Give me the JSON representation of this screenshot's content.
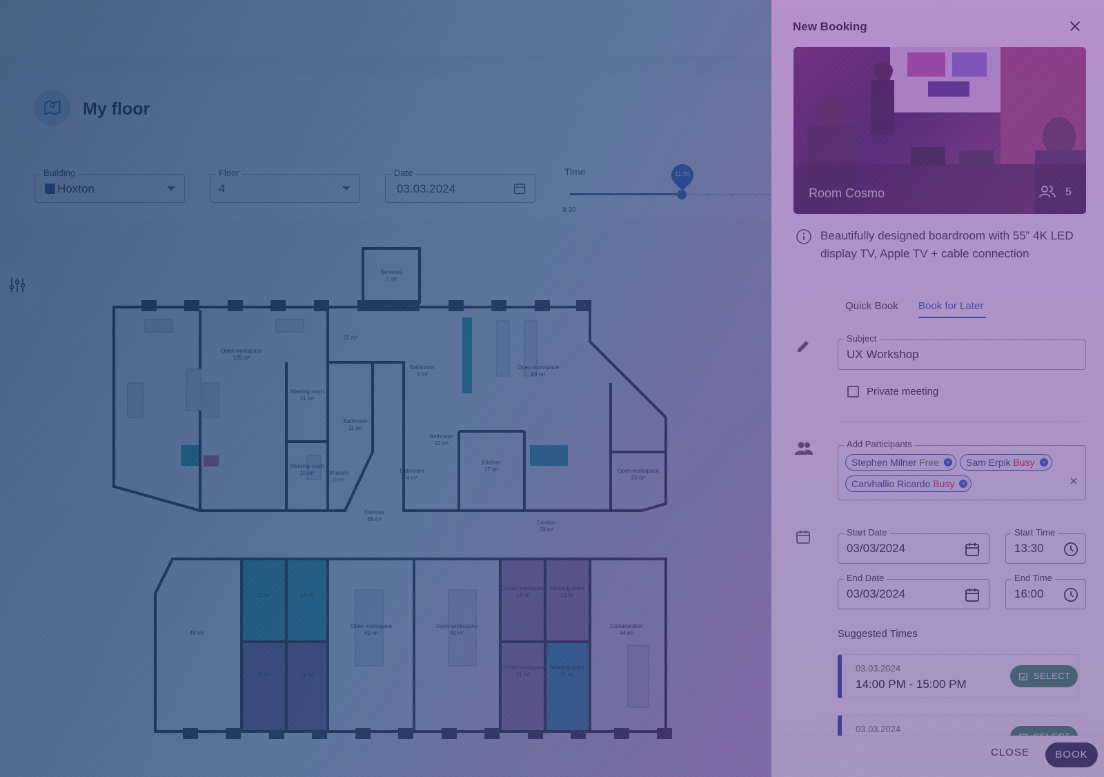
{
  "page": {
    "title": "My floor"
  },
  "filters": {
    "building_label": "Building",
    "building_value": "Hoxton",
    "floor_label": "Floor",
    "floor_value": "4",
    "date_label": "Date",
    "date_value": "03.03.2024",
    "time_label": "Time",
    "time_value": "11:00",
    "time_start": "8:30"
  },
  "floorplan": {
    "rooms": [
      {
        "name": "Services",
        "area": "7 m²"
      },
      {
        "name": "Open workspace",
        "area": "125 m²"
      },
      {
        "name": "",
        "area": "22 m²"
      },
      {
        "name": "Bathroom",
        "area": "4 m²"
      },
      {
        "name": "Open workspace",
        "area": "86 m²"
      },
      {
        "name": "Meeting room",
        "area": "11 m²"
      },
      {
        "name": "Bathroom",
        "area": "11 m²"
      },
      {
        "name": "Bathroom",
        "area": "12 m²"
      },
      {
        "name": "Kitchen",
        "area": "17 m²"
      },
      {
        "name": "Meeting room",
        "area": "10 m²"
      },
      {
        "name": "Bathroom",
        "area": "3 m²"
      },
      {
        "name": "Bathroom",
        "area": "4 m²"
      },
      {
        "name": "Open workspace",
        "area": "20 m²"
      },
      {
        "name": "Corridor",
        "area": "66 m²"
      },
      {
        "name": "Corridor",
        "area": "38 m²"
      },
      {
        "name": "",
        "area": "48 m²"
      },
      {
        "name": "",
        "area": "13 m²"
      },
      {
        "name": "",
        "area": "13 m²"
      },
      {
        "name": "Open workspace",
        "area": "49 m²"
      },
      {
        "name": "Open workspace",
        "area": "49 m²"
      },
      {
        "name": "Closed workspace",
        "area": "13 m²"
      },
      {
        "name": "Meeting room",
        "area": "13 m²"
      },
      {
        "name": "Collaboration",
        "area": "44 m²"
      },
      {
        "name": "",
        "area": "11 m²"
      },
      {
        "name": "",
        "area": "11 m²"
      },
      {
        "name": "Closed workspace",
        "area": "11 m²"
      },
      {
        "name": "Meeting room",
        "area": "11 m²"
      }
    ]
  },
  "drawer": {
    "title": "New Booking",
    "room_name": "Room Cosmo",
    "room_capacity": "5",
    "description": "Beautifully designed boardroom with 55” 4K LED display TV, Apple TV + cable connection",
    "tabs": [
      "Quick Book",
      "Book for Later"
    ],
    "subject_label": "Subject",
    "subject_value": "UX Workshop",
    "private_label": "Private meeting",
    "participants_label": "Add Participants",
    "participants": [
      {
        "name": "Stephen Milner",
        "status": "Free"
      },
      {
        "name": "Sam Erpik",
        "status": "Busy"
      },
      {
        "name": "Carvhallio Ricardo",
        "status": "Busy"
      }
    ],
    "start_date_label": "Start Date",
    "start_date_value": "03/03/2024",
    "start_time_label": "Start Time",
    "start_time_value": "13:30",
    "end_date_label": "End Date",
    "end_date_value": "03/03/2024",
    "end_time_label": "End Time",
    "end_time_value": "16:00",
    "suggested_title": "Suggested Times",
    "suggestions": [
      {
        "date": "03.03.2024",
        "range": "14:00 PM - 15:00 PM",
        "button": "SELECT"
      },
      {
        "date": "03.03.2024",
        "range": "",
        "button": "SELECT"
      }
    ],
    "close_label": "CLOSE",
    "book_label": "BOOK"
  },
  "colors": {
    "accent": "#1e5bb8",
    "free": "#2e8b3e",
    "busy": "#c62828",
    "select_button": "#2e8b57",
    "book_button": "#1e2a3a"
  }
}
